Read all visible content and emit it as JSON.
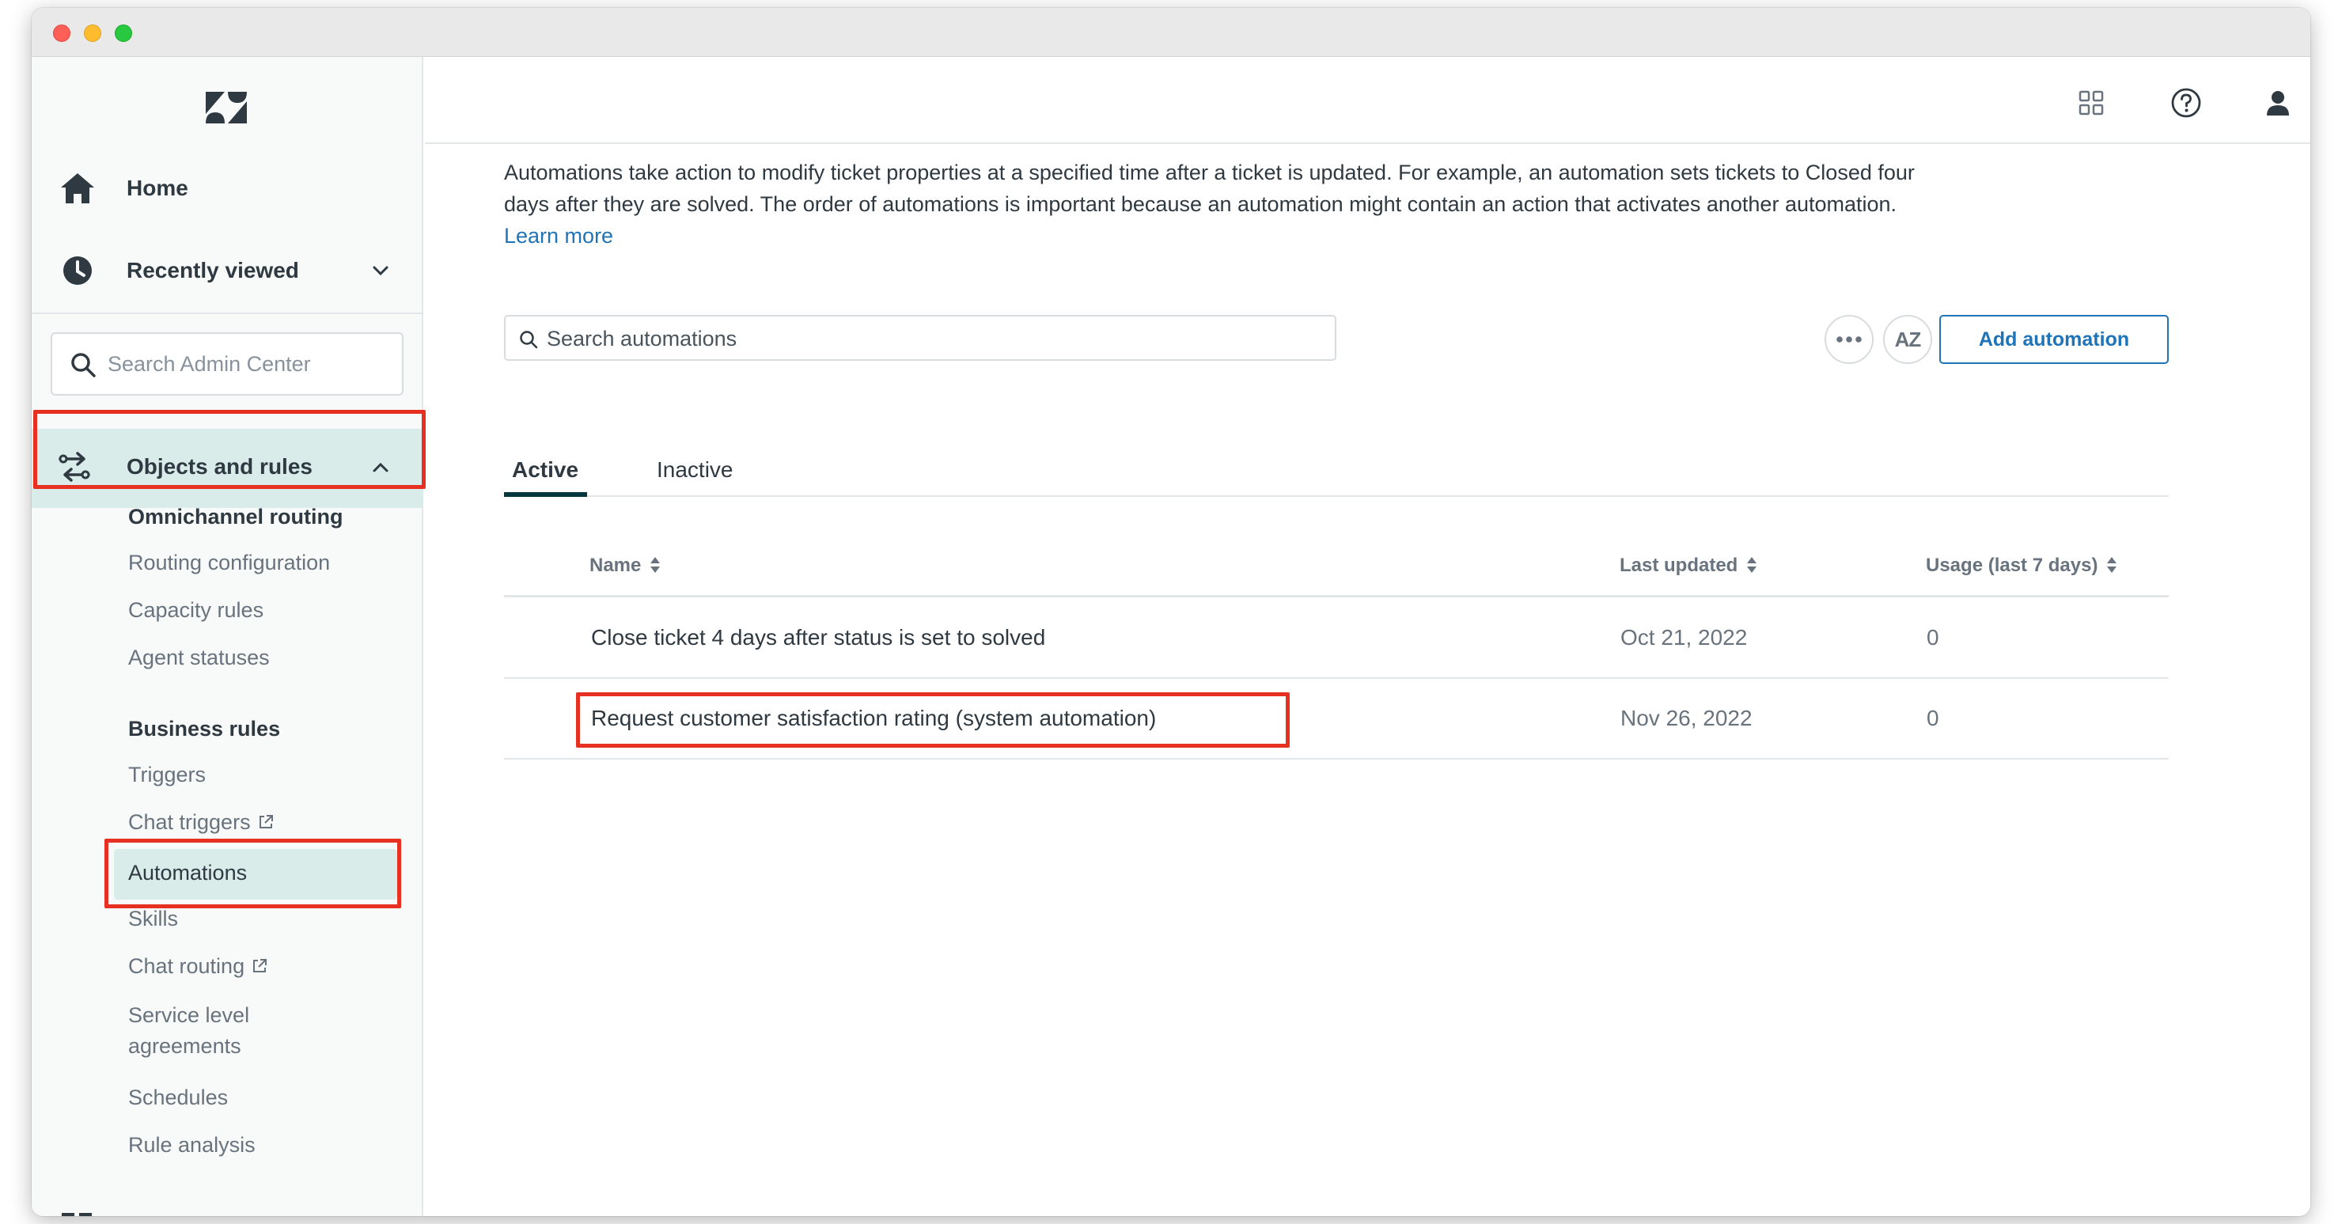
{
  "sidebar": {
    "home_label": "Home",
    "recently_viewed_label": "Recently viewed",
    "search_placeholder": "Search Admin Center",
    "objects_label": "Objects and rules",
    "groups": [
      {
        "title": "Omnichannel routing",
        "items": [
          "Routing configuration",
          "Capacity rules",
          "Agent statuses"
        ]
      },
      {
        "title": "Business rules",
        "items": [
          "Triggers",
          "Chat triggers",
          "Automations",
          "Skills",
          "Chat routing",
          "Service level",
          "agreements",
          "Schedules",
          "Rule analysis"
        ]
      }
    ]
  },
  "main": {
    "description": "Automations take action to modify ticket properties at a specified time after a ticket is updated. For example, an automation sets tickets to Closed four days after they are solved. The order of automations is important because an automation might contain an action that activates another automation.",
    "learn_more": "Learn more",
    "search_placeholder": "Search automations",
    "sort_label": "AZ",
    "add_button": "Add automation",
    "tabs": [
      {
        "label": "Active",
        "selected": true
      },
      {
        "label": "Inactive",
        "selected": false
      }
    ],
    "table": {
      "headers": [
        "Name",
        "Last updated",
        "Usage (last 7 days)"
      ],
      "rows": [
        {
          "name": "Close ticket 4 days after status is set to solved",
          "updated": "Oct 21, 2022",
          "usage": "0"
        },
        {
          "name": "Request customer satisfaction rating (system automation)",
          "updated": "Nov 26, 2022",
          "usage": "0"
        }
      ]
    }
  },
  "icons": {
    "logo": "zendesk-logo",
    "home": "home-icon",
    "recent": "clock-icon",
    "objects": "objects-rules-icon",
    "products": "grid-icon",
    "help": "help-icon",
    "profile": "user-icon"
  },
  "colors": {
    "highlight": "#e63022",
    "selected_bg": "#d9ecea",
    "link": "#1f73b7",
    "tab_active": "#03363d"
  }
}
